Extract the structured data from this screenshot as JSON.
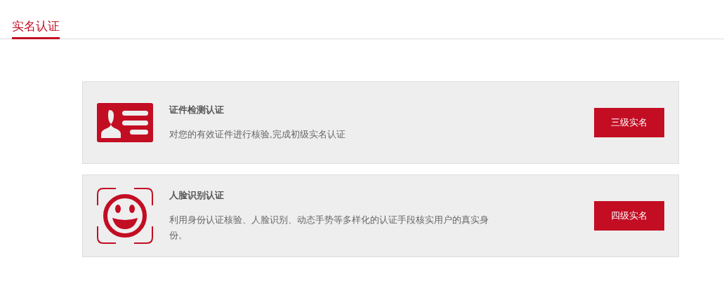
{
  "tabs": [
    {
      "label": "实名认证",
      "selected": true
    }
  ],
  "cards": [
    {
      "kind": "id_card",
      "title": "证件检测认证",
      "description": "对您的有效证件进行核验,完成初级实名认证",
      "button": "三级实名"
    },
    {
      "kind": "face",
      "title": "人脸识别认证",
      "description": "利用身份认证核验、人脸识别、动态手势等多样化的认证手段核实用户的真实身份。",
      "button": "四级实名"
    }
  ]
}
